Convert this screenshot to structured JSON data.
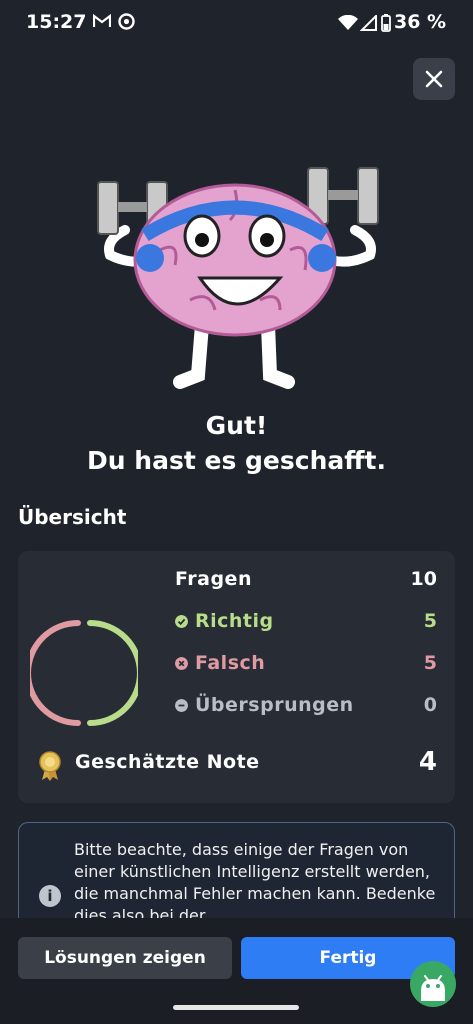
{
  "status_bar": {
    "time": "15:27",
    "battery": "36 %",
    "icons": [
      "gmail-icon",
      "chrome-icon",
      "wifi-icon",
      "signal-icon",
      "battery-icon"
    ]
  },
  "headline": {
    "line1": "Gut!",
    "line2": "Du hast es geschafft."
  },
  "overview": {
    "title": "Übersicht",
    "questions_label": "Fragen",
    "questions_value": "10",
    "correct_label": "Richtig",
    "correct_value": "5",
    "wrong_label": "Falsch",
    "wrong_value": "5",
    "skipped_label": "Übersprungen",
    "skipped_value": "0",
    "grade_label": "Geschätzte Note",
    "grade_value": "4",
    "colors": {
      "correct": "#b9dc8a",
      "wrong": "#e09aa2",
      "skipped": "#b9bec6"
    }
  },
  "info": {
    "text": "Bitte beachte, dass einige der Fragen von einer künstlichen Intelligenz erstellt werden, die manchmal Fehler machen kann. Bedenke dies also bei der"
  },
  "actions": {
    "show_solutions": "Lösungen zeigen",
    "done": "Fertig"
  },
  "accent_color": "#2f7df4"
}
